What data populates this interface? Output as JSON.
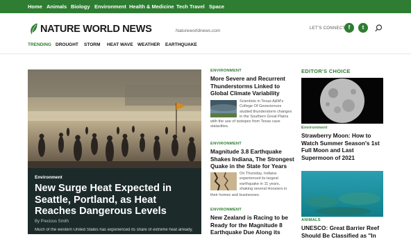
{
  "topnav": {
    "items": [
      "Home",
      "Animals",
      "Biology",
      "Environment",
      "Health & Medicine",
      "Tech Travel",
      "Space"
    ]
  },
  "header": {
    "logo": "NATURE WORLD NEWS",
    "domain": "Natureworldnews.com",
    "connect_label": "LET'S CONNECT",
    "social": [
      "f",
      "t"
    ]
  },
  "trending": {
    "label": "TRENDING",
    "items": [
      "DROUGHT",
      "STORM",
      "HEAT WAVE",
      "WEATHER",
      "EARTHQUAKE"
    ]
  },
  "hero": {
    "category": "Environment",
    "title": "New Surge Heat Expected in Seattle, Portland, as Heat Reaches Dangerous Levels",
    "byline": "By Precious Smith",
    "excerpt": "Much of the western United States has experienced its share of extreme heat already,"
  },
  "middle": {
    "articles": [
      {
        "category": "ENVIRONMENT",
        "headline": "More Severe and Recurrent Thunderstorms Linked to Global Climate Variability",
        "summary_lines": [
          "Scientists in Texas A&M's",
          "College Of Geosciences",
          "studied thunderstorm changes",
          "in the Southern Great Plains",
          "with the use of isotopes from Texas cave",
          "stalactites."
        ]
      },
      {
        "category": "ENVIRONMENT",
        "headline": "Magnitude 3.8 Earthquake Shakes Indiana, The Strongest Quake in the State for Years",
        "summary_lines": [
          "On Thursday, Indiana",
          "experienced its largest",
          "earthquake in 11 years,",
          "shaking several Hoosiers in",
          "their homes and businesses."
        ]
      },
      {
        "category": "ENVIRONMENT",
        "headline": "New Zealand is Racing to be Ready for the Magnitude 8 Earthquake Due Along its"
      }
    ]
  },
  "editors": {
    "title": "EDITOR'S CHOICE",
    "articles": [
      {
        "category": "Environment",
        "headline": "Strawberry Moon: How to Watch Summer Season's 1st Full Moon and Last Supermoon of 2021"
      },
      {
        "category": "ANIMALS",
        "headline": "UNESCO: Great Barrier Reef Should Be Classified as \"In"
      }
    ]
  },
  "colors": {
    "brand_green": "#2e7d32",
    "hero_box": "#1c2a2a"
  }
}
